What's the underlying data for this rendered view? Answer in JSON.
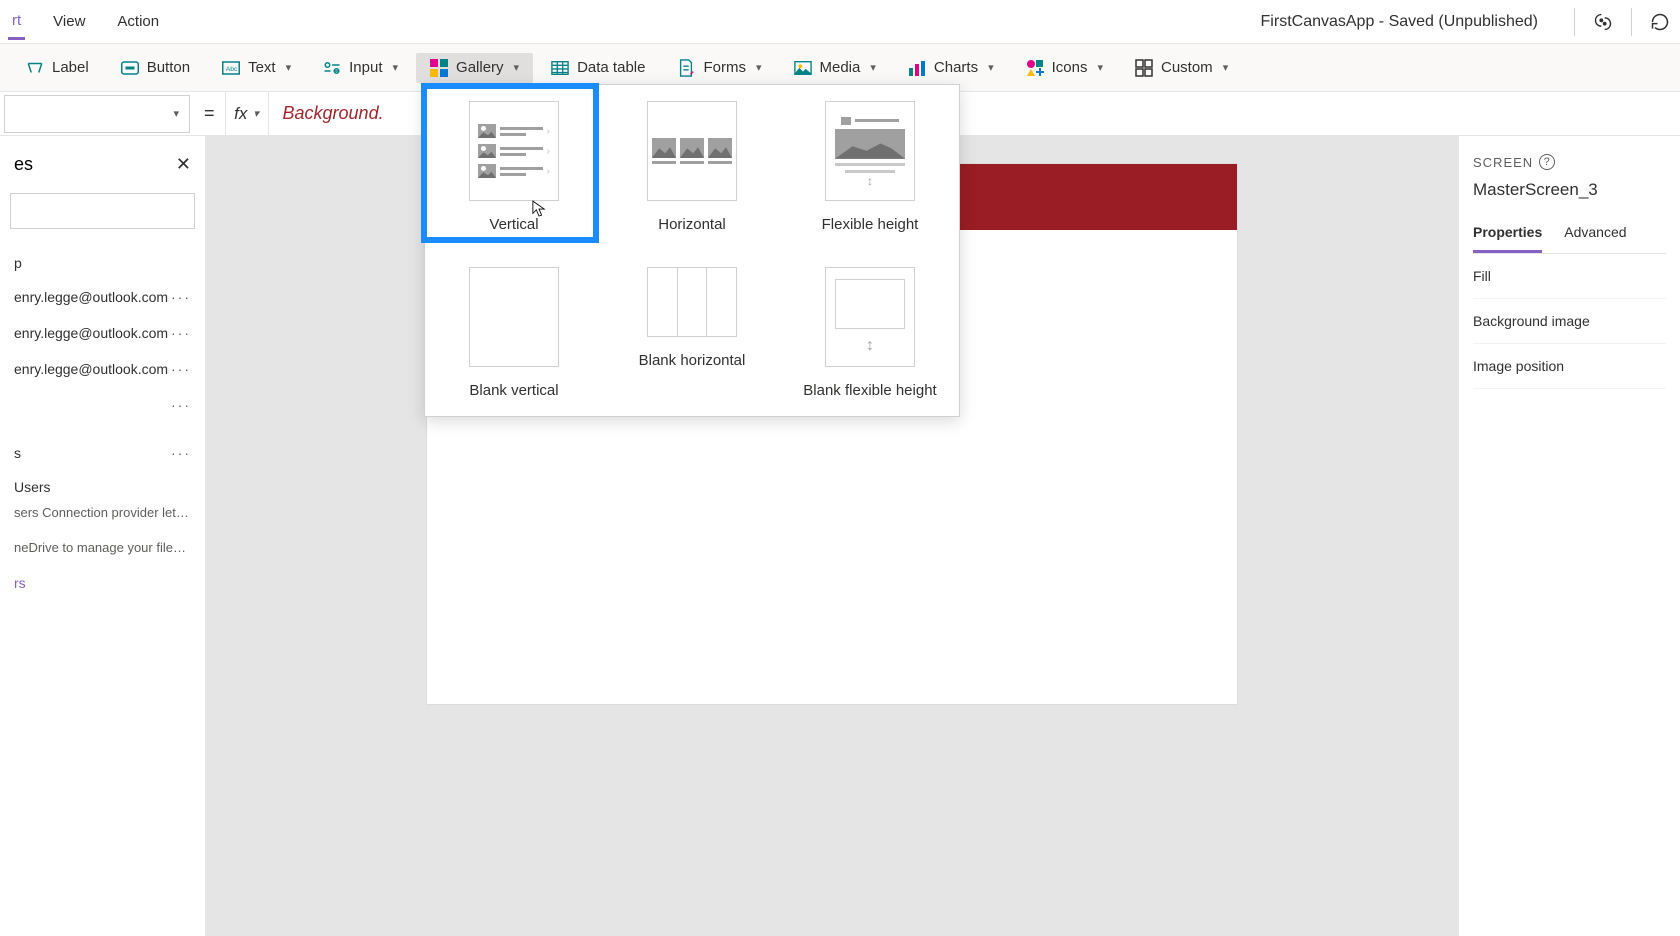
{
  "menubar": {
    "items": [
      "rt",
      "View",
      "Action"
    ],
    "app_title": "FirstCanvasApp - Saved (Unpublished)"
  },
  "ribbon": {
    "label": "Label",
    "button": "Button",
    "text": "Text",
    "input": "Input",
    "gallery": "Gallery",
    "datatable": "Data table",
    "forms": "Forms",
    "media": "Media",
    "charts": "Charts",
    "icons": "Icons",
    "custom": "Custom"
  },
  "formula": {
    "eq": "=",
    "fx": "fx",
    "value": "Background."
  },
  "left_panel": {
    "title": "es",
    "p_heading": "p",
    "emails": [
      "enry.legge@outlook.com",
      "enry.legge@outlook.com",
      "enry.legge@outlook.com"
    ],
    "s_heading": "s",
    "users_title": "Users",
    "users_desc": "sers Connection provider lets you ...",
    "onedrive_desc": "neDrive to manage your files. Yo...",
    "link": "rs"
  },
  "right_panel": {
    "label": "SCREEN",
    "screen_name": "MasterScreen_3",
    "tabs": {
      "properties": "Properties",
      "advanced": "Advanced"
    },
    "props": [
      "Fill",
      "Background image",
      "Image position"
    ]
  },
  "gallery": {
    "options": [
      {
        "label": "Vertical"
      },
      {
        "label": "Horizontal"
      },
      {
        "label": "Flexible height"
      },
      {
        "label": "Blank vertical"
      },
      {
        "label": "Blank horizontal"
      },
      {
        "label": "Blank flexible height"
      }
    ]
  }
}
